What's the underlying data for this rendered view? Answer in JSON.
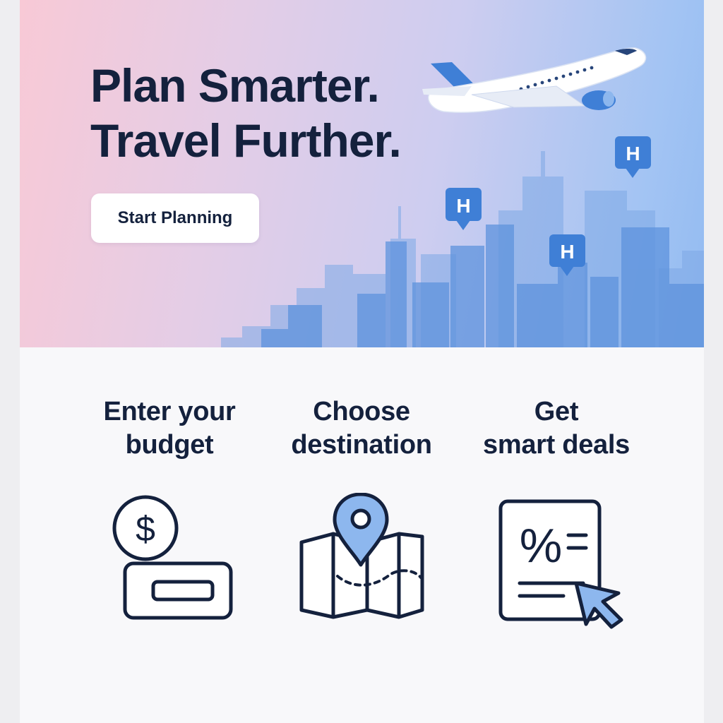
{
  "hero": {
    "title_line1": "Plan Smarter.",
    "title_line2": "Travel Further.",
    "cta_label": "Start Planning",
    "hotel_marker_letter": "H"
  },
  "steps": [
    {
      "line1": "Enter your",
      "line2": "budget",
      "icon": "budget-icon"
    },
    {
      "line1": "Choose",
      "line2": "destination",
      "icon": "map-pin-icon"
    },
    {
      "line1": "Get",
      "line2": "smart deals",
      "icon": "deals-document-icon"
    }
  ],
  "icons": {
    "dollar_symbol": "$",
    "percent_symbol": "%"
  },
  "colors": {
    "text_dark": "#14213d",
    "accent_blue": "#3f7fd6",
    "light_blue": "#8db7ee",
    "city_blue": "#6f9fe0",
    "page_bg": "#f8f8fa"
  }
}
